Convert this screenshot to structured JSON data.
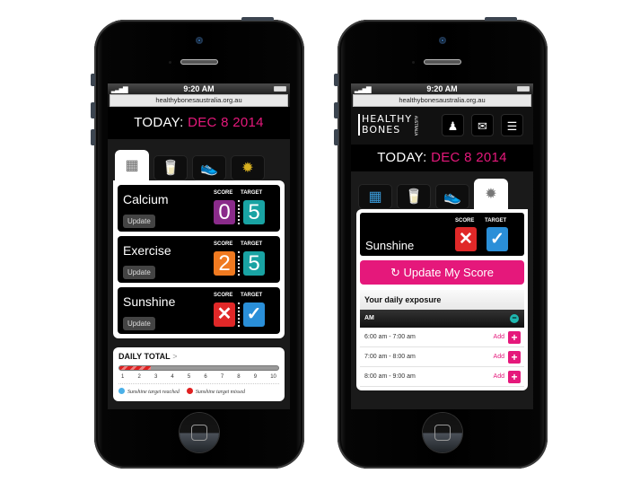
{
  "phone1": {
    "status": {
      "time": "9:20 AM",
      "signal_icon": "signal-bars",
      "battery_icon": "battery"
    },
    "url": "healthybonesaustralia.org.au",
    "today": {
      "label": "TODAY:",
      "date": "DEC 8 2014"
    },
    "tabs": [
      {
        "name": "calculator",
        "icon": "▦",
        "active": true
      },
      {
        "name": "calcium-food",
        "icon": "🥛",
        "active": false
      },
      {
        "name": "exercise-shoe",
        "icon": "👟",
        "active": false
      },
      {
        "name": "sunshine",
        "icon": "✹",
        "active": false
      }
    ],
    "score_label": "SCORE",
    "target_label": "TARGET",
    "cards": [
      {
        "title": "Calcium",
        "update": "Update",
        "score": "0",
        "score_color": "#8a2b8a",
        "target": "5",
        "target_color": "#19a3a3"
      },
      {
        "title": "Exercise",
        "update": "Update",
        "score": "2",
        "score_color": "#f07a20",
        "target": "5",
        "target_color": "#19a3a3"
      },
      {
        "title": "Sunshine",
        "update": "Update",
        "score": "✕",
        "score_color": "#e02828",
        "target": "✓",
        "target_color": "#2a8fd8"
      }
    ],
    "daily_total": {
      "title": "DAILY TOTAL",
      "chevron": ">",
      "progress_fraction": 0.2,
      "ticks": [
        "1",
        "2",
        "3",
        "4",
        "5",
        "6",
        "7",
        "8",
        "9",
        "10"
      ],
      "legend": [
        {
          "label": "Sunshine target reached",
          "color": "#4ab0e8"
        },
        {
          "label": "Sunshine target missed",
          "color": "#e02020"
        }
      ]
    }
  },
  "phone2": {
    "status": {
      "time": "9:20 AM",
      "signal_icon": "signal-bars",
      "battery_icon": "battery"
    },
    "url": "healthybonesaustralia.org.au",
    "logo": {
      "line1": "HEALTHY",
      "line2": "BONES",
      "sub": "AUSTRALIA"
    },
    "header_buttons": [
      {
        "name": "skeleton",
        "icon": "♟"
      },
      {
        "name": "mail",
        "icon": "✉"
      },
      {
        "name": "menu",
        "icon": "☰"
      }
    ],
    "today": {
      "label": "TODAY:",
      "date": "DEC 8 2014"
    },
    "tabs": [
      {
        "name": "calculator",
        "icon": "▦",
        "active": false
      },
      {
        "name": "calcium-food",
        "icon": "🥛",
        "active": false
      },
      {
        "name": "exercise-shoe",
        "icon": "👟",
        "active": false
      },
      {
        "name": "sunshine",
        "icon": "✹",
        "active": true
      }
    ],
    "sunshine_card": {
      "title": "Sunshine",
      "score_label": "SCORE",
      "target_label": "TARGET",
      "score": "✕",
      "score_color": "#e02828",
      "target": "✓",
      "target_color": "#2a8fd8"
    },
    "update_button": {
      "icon": "↻",
      "label": "Update My Score"
    },
    "exposure": {
      "title": "Your daily exposure",
      "section": "AM",
      "collapse_icon": "−",
      "slots": [
        {
          "time": "6:00 am - 7:00 am",
          "add": "Add",
          "plus": "+"
        },
        {
          "time": "7:00 am - 8:00 am",
          "add": "Add",
          "plus": "+"
        },
        {
          "time": "8:00 am - 9:00 am",
          "add": "Add",
          "plus": "+"
        }
      ]
    }
  }
}
